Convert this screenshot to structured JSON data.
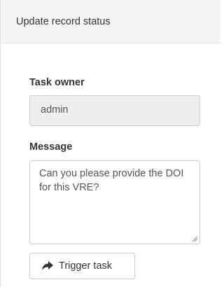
{
  "header": {
    "title": "Update record status"
  },
  "form": {
    "task_owner": {
      "label": "Task owner",
      "value": "admin"
    },
    "message": {
      "label": "Message",
      "value": "Can you please provide the DOI for this VRE?"
    },
    "trigger_button": {
      "label": "Trigger task",
      "icon": "share-forward-icon"
    }
  }
}
